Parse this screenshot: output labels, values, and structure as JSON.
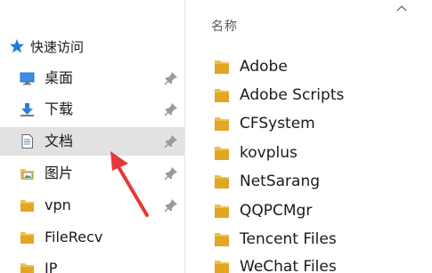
{
  "nav": {
    "quick_access": "快速访问",
    "items": [
      {
        "label": "桌面",
        "icon": "desktop-icon",
        "pinned": true,
        "selected": false
      },
      {
        "label": "下载",
        "icon": "download-icon",
        "pinned": true,
        "selected": false
      },
      {
        "label": "文档",
        "icon": "document-icon",
        "pinned": true,
        "selected": true
      },
      {
        "label": "图片",
        "icon": "pictures-icon",
        "pinned": true,
        "selected": false
      },
      {
        "label": "vpn",
        "icon": "folder-icon",
        "pinned": true,
        "selected": false
      },
      {
        "label": "FileRecv",
        "icon": "folder-icon",
        "pinned": false,
        "selected": false
      },
      {
        "label": "IP",
        "icon": "folder-icon",
        "pinned": false,
        "selected": false
      }
    ]
  },
  "content": {
    "column_header": "名称",
    "files": [
      {
        "label": "Adobe",
        "icon": "folder-icon"
      },
      {
        "label": "Adobe Scripts",
        "icon": "folder-icon"
      },
      {
        "label": "CFSystem",
        "icon": "folder-icon"
      },
      {
        "label": "kovplus",
        "icon": "folder-icon"
      },
      {
        "label": "NetSarang",
        "icon": "folder-icon"
      },
      {
        "label": "QQPCMgr",
        "icon": "folder-icon"
      },
      {
        "label": "Tencent Files",
        "icon": "folder-icon"
      },
      {
        "label": "WeChat Files",
        "icon": "folder-icon"
      }
    ]
  },
  "colors": {
    "folder": "#f1c04a",
    "folder_dark": "#e0a722",
    "selected_bg": "#e2e2e2",
    "arrow": "#e53935",
    "star": "#1e7bd8"
  }
}
